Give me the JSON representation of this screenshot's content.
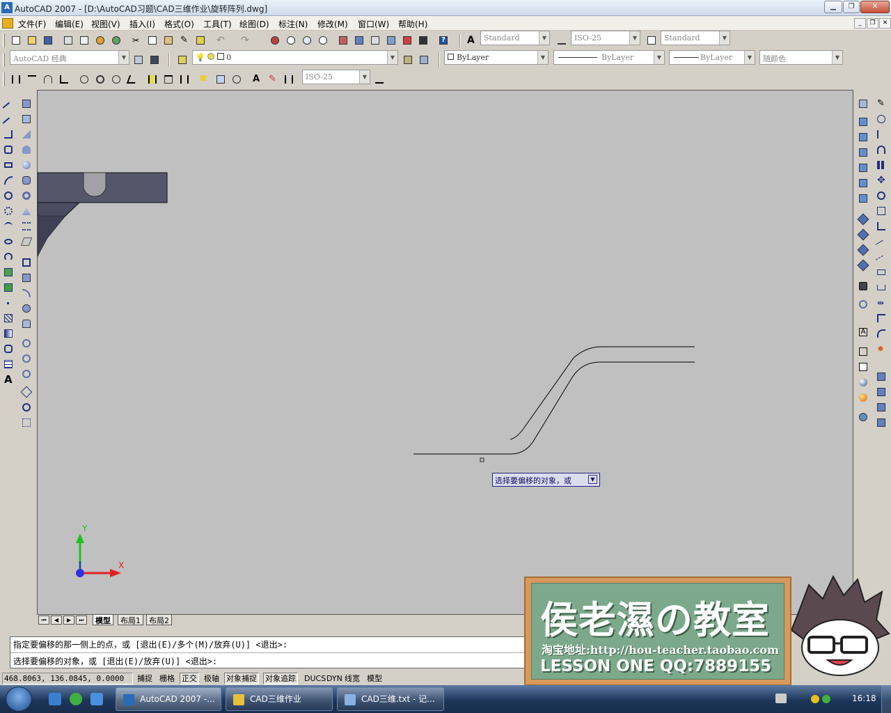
{
  "title_bar": {
    "title": "AutoCAD 2007 - [D:\\AutoCAD习题\\CAD三维作业\\旋转阵列.dwg]"
  },
  "menu": [
    "文件(F)",
    "编辑(E)",
    "视图(V)",
    "插入(I)",
    "格式(O)",
    "工具(T)",
    "绘图(D)",
    "标注(N)",
    "修改(M)",
    "窗口(W)",
    "帮助(H)"
  ],
  "toolbars": {
    "text_style": "Standard",
    "dim_style": "ISO-25",
    "table_style": "Standard",
    "workspace": "AutoCAD 经典",
    "layer": "0",
    "color": "ByLayer",
    "linetype": "ByLayer",
    "lineweight": "ByLayer",
    "plot_style": "随颜色",
    "dim_style_2": "ISO-25"
  },
  "layout_tabs": [
    "模型",
    "布局1",
    "布局2"
  ],
  "canvas": {
    "tooltip": "选择要偏移的对象，或",
    "ucs": {
      "x": "X",
      "y": "Y"
    }
  },
  "command": {
    "line1": "指定要偏移的那一侧上的点，或 [退出(E)/多个(M)/放弃(U)] <退出>:",
    "line2": "选择要偏移的对象，或 [退出(E)/放弃(U)] <退出>:"
  },
  "status": {
    "coords": "468.8063, 136.0845, 0.0000",
    "toggles": [
      "捕捉",
      "栅格",
      "正交",
      "极轴",
      "对象捕捉",
      "对象追踪",
      "DUCS",
      "DYN",
      "线宽",
      "模型"
    ]
  },
  "watermark": {
    "title": "侯老濕の教室",
    "url": "淘宝地址:http://hou-teacher.taobao.com",
    "lesson": "LESSON ONE QQ:7889155"
  },
  "taskbar": {
    "items": [
      "AutoCAD 2007 -...",
      "CAD三维作业",
      "CAD三维.txt - 记..."
    ],
    "clock": "16:18"
  },
  "colors": {
    "canvas_bg": "#c0c0c0",
    "ui_bg": "#d4d0c8",
    "ucs_x": "#e02020",
    "ucs_y": "#20c020"
  }
}
